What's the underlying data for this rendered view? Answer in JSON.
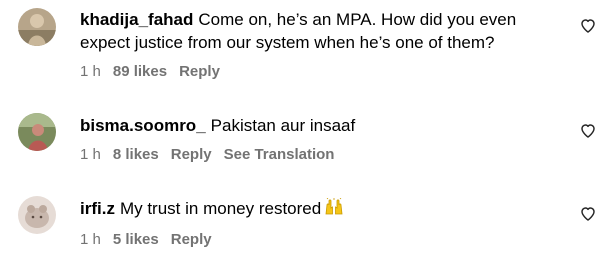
{
  "comments": [
    {
      "username": "khadija_fahad",
      "text": "Come on, he’s an MPA. How did you even expect justice from our system when he’s one of them?",
      "time": "1 h",
      "likes": "89 likes",
      "reply": "Reply",
      "avatar_icon": "profile-photo"
    },
    {
      "username": "bisma.soomro_",
      "text": "Pakistan aur insaaf",
      "time": "1 h",
      "likes": "8 likes",
      "reply": "Reply",
      "translation": "See Translation",
      "avatar_icon": "profile-photo"
    },
    {
      "username": "irfi.z",
      "text": "My trust in money restored",
      "emoji": "raising-hands-emoji",
      "time": "1 h",
      "likes": "5 likes",
      "reply": "Reply",
      "avatar_icon": "profile-photo"
    }
  ],
  "like_icon": "heart-outline-icon",
  "colors": {
    "text": "#000000",
    "meta": "#737373",
    "emoji": "#f5c518"
  }
}
